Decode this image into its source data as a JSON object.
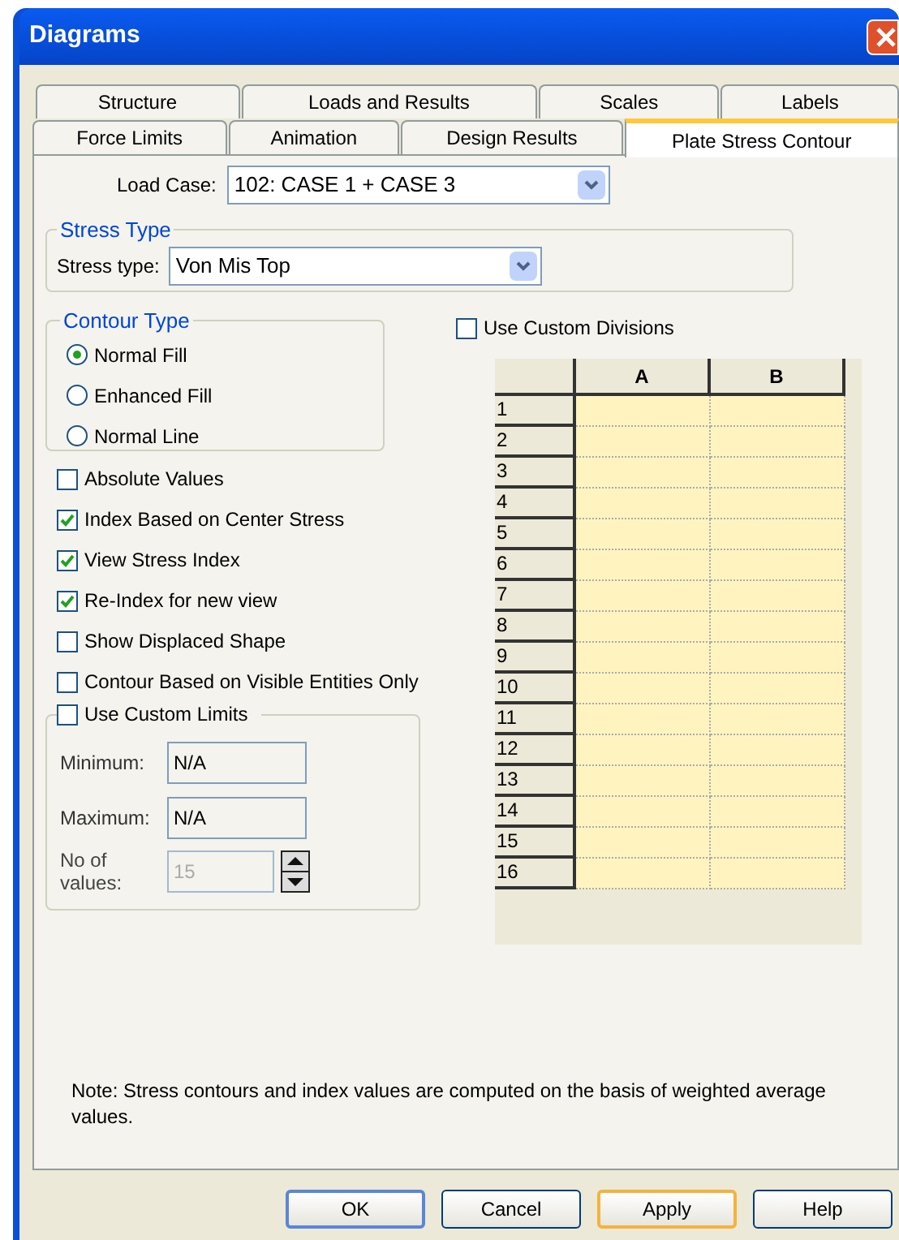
{
  "window": {
    "title": "Diagrams"
  },
  "tab_rows": [
    [
      {
        "label": "Structure",
        "selected": false
      },
      {
        "label": "Loads and Results",
        "selected": false
      },
      {
        "label": "Scales",
        "selected": false
      },
      {
        "label": "Labels",
        "selected": false
      }
    ],
    [
      {
        "label": "Force Limits",
        "selected": false
      },
      {
        "label": "Animation",
        "selected": false
      },
      {
        "label": "Design Results",
        "selected": false
      },
      {
        "label": "Plate Stress Contour",
        "selected": true
      }
    ]
  ],
  "load_case": {
    "label": "Load Case:",
    "value": "102: CASE 1 + CASE 3"
  },
  "stress_type": {
    "title": "Stress Type",
    "label": "Stress type:",
    "value": "Von Mis Top"
  },
  "contour_type": {
    "title": "Contour Type",
    "options": [
      {
        "label": "Normal Fill",
        "selected": true
      },
      {
        "label": "Enhanced Fill",
        "selected": false
      },
      {
        "label": "Normal Line",
        "selected": false
      }
    ]
  },
  "checkboxes": [
    {
      "label": "Absolute Values",
      "checked": false
    },
    {
      "label": "Index Based on Center Stress",
      "checked": true
    },
    {
      "label": "View Stress Index",
      "checked": true
    },
    {
      "label": "Re-Index for new view",
      "checked": true
    },
    {
      "label": "Show Displaced Shape",
      "checked": false
    },
    {
      "label": "Contour Based on Visible Entities Only",
      "checked": false
    }
  ],
  "custom_limits": {
    "label": "Use Custom Limits",
    "checked": false,
    "minimum": {
      "label": "Minimum:",
      "value": "N/A"
    },
    "maximum": {
      "label": "Maximum:",
      "value": "N/A"
    },
    "count": {
      "label": "No of values:",
      "value": "15",
      "disabled": true
    }
  },
  "custom_divisions": {
    "label": "Use Custom Divisions",
    "checked": false
  },
  "divisions_table": {
    "columns": [
      "A",
      "B"
    ],
    "rows": [
      "1",
      "2",
      "3",
      "4",
      "5",
      "6",
      "7",
      "8",
      "9",
      "10",
      "11",
      "12",
      "13",
      "14",
      "15",
      "16"
    ]
  },
  "note": "Note: Stress contours and index values are computed on the basis of weighted average values.",
  "buttons": [
    {
      "label": "OK",
      "kind": "default"
    },
    {
      "label": "Cancel",
      "kind": "normal"
    },
    {
      "label": "Apply",
      "kind": "hot"
    },
    {
      "label": "Help",
      "kind": "normal"
    }
  ]
}
